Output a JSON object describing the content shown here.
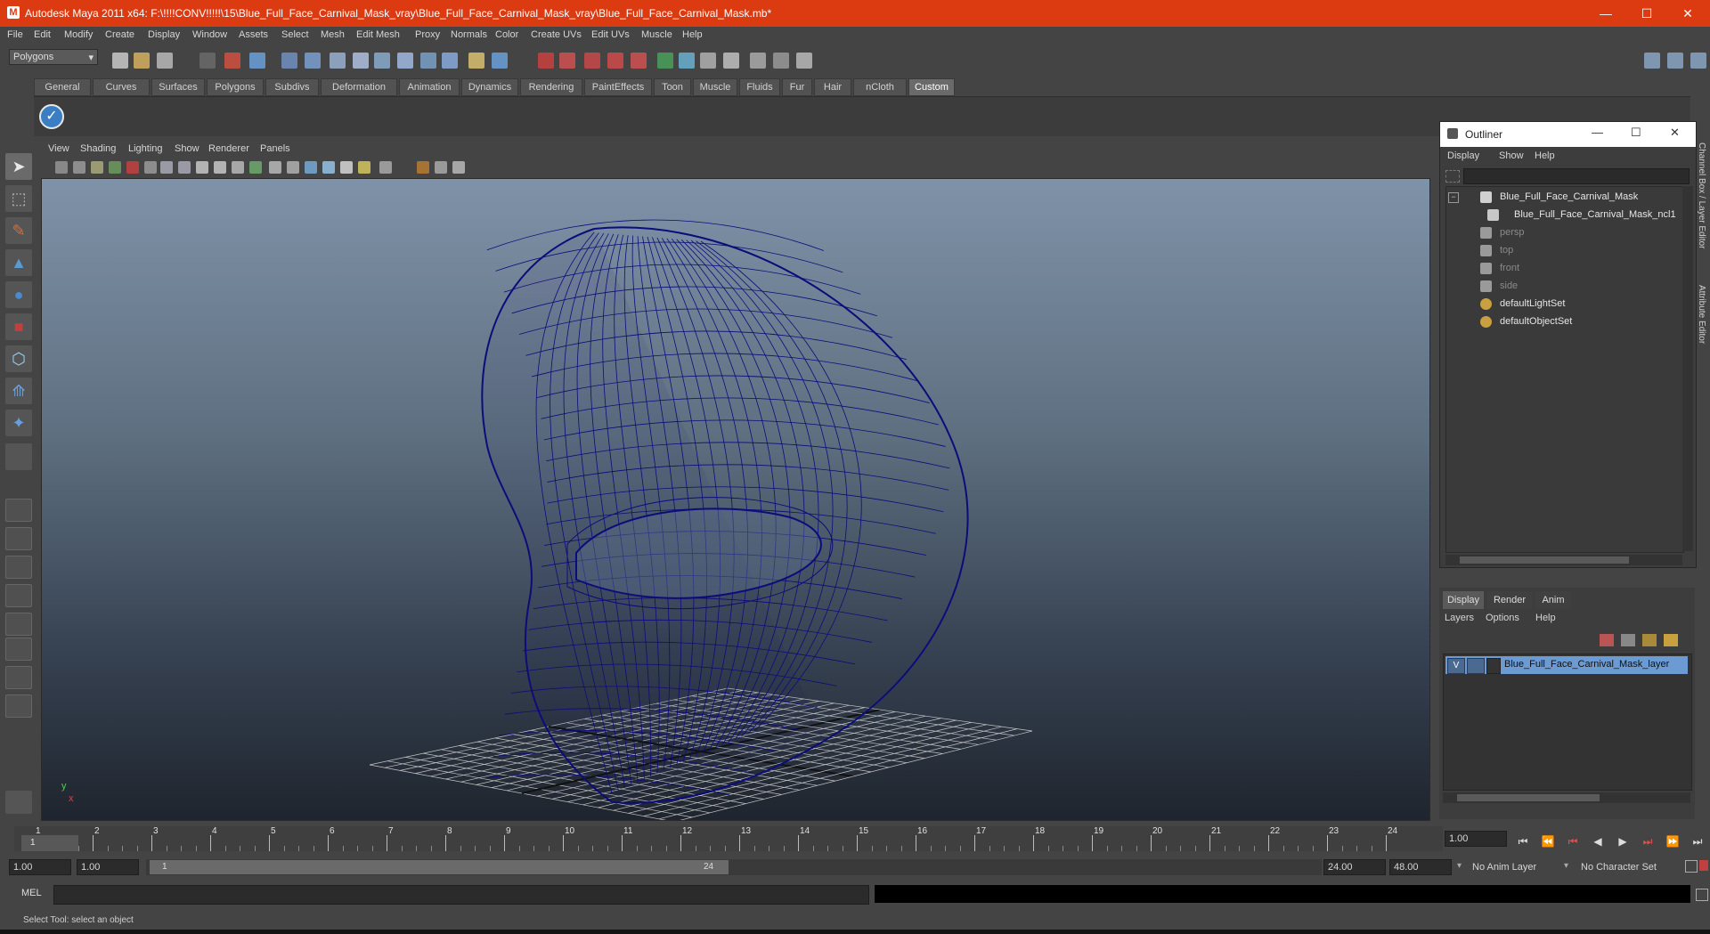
{
  "window": {
    "title": "Autodesk Maya 2011 x64: F:\\!!!!CONV!!!!!\\15\\Blue_Full_Face_Carnival_Mask_vray\\Blue_Full_Face_Carnival_Mask_vray\\Blue_Full_Face_Carnival_Mask.mb*",
    "minimize": "—",
    "maximize": "☐",
    "close": "✕"
  },
  "menubar": [
    "File",
    "Edit",
    "Modify",
    "Create",
    "Display",
    "Window",
    "Assets",
    "Select",
    "Mesh",
    "Edit Mesh",
    "Proxy",
    "Normals",
    "Color",
    "Create UVs",
    "Edit UVs",
    "Muscle",
    "Help"
  ],
  "status": {
    "menu_set": "Polygons"
  },
  "shelf": {
    "tabs": [
      "General",
      "Curves",
      "Surfaces",
      "Polygons",
      "Subdivs",
      "Deformation",
      "Animation",
      "Dynamics",
      "Rendering",
      "PaintEffects",
      "Toon",
      "Muscle",
      "Fluids",
      "Fur",
      "Hair",
      "nCloth",
      "Custom"
    ],
    "active": "Custom"
  },
  "panel_menu": [
    "View",
    "Shading",
    "Lighting",
    "Show",
    "Renderer",
    "Panels"
  ],
  "viewport": {
    "axis_x": "x",
    "axis_y": "y",
    "wire_color": "#0c0c7a"
  },
  "outliner": {
    "title": "Outliner",
    "menu": [
      "Display",
      "Show",
      "Help"
    ],
    "items": [
      {
        "label": "Blue_Full_Face_Carnival_Mask",
        "dim": false,
        "icon": "mesh-group-icon"
      },
      {
        "label": "Blue_Full_Face_Carnival_Mask_ncl1",
        "dim": false,
        "icon": "mesh-shape-icon"
      },
      {
        "label": "persp",
        "dim": true,
        "icon": "camera-icon"
      },
      {
        "label": "top",
        "dim": true,
        "icon": "camera-icon"
      },
      {
        "label": "front",
        "dim": true,
        "icon": "camera-icon"
      },
      {
        "label": "side",
        "dim": true,
        "icon": "camera-icon"
      },
      {
        "label": "defaultLightSet",
        "dim": false,
        "icon": "set-icon"
      },
      {
        "label": "defaultObjectSet",
        "dim": false,
        "icon": "set-icon"
      }
    ]
  },
  "side_tabs": {
    "channel_box": "Channel Box / Layer Editor",
    "attribute_editor": "Attribute Editor"
  },
  "layer_editor": {
    "tabs": [
      "Display",
      "Render",
      "Anim"
    ],
    "active_tab": "Display",
    "menu": [
      "Layers",
      "Options",
      "Help"
    ],
    "layer": {
      "visible": "V",
      "name": "Blue_Full_Face_Carnival_Mask_layer"
    }
  },
  "time_slider": {
    "ticks": [
      "1",
      "2",
      "3",
      "4",
      "5",
      "6",
      "7",
      "8",
      "9",
      "10",
      "11",
      "12",
      "13",
      "14",
      "15",
      "16",
      "17",
      "18",
      "19",
      "20",
      "21",
      "22",
      "23",
      "24"
    ],
    "current_frame_marker": "1",
    "current_time": "1.00"
  },
  "range_slider": {
    "start": "1.00",
    "anim_start": "1.00",
    "range_start": "1",
    "range_end": "24",
    "anim_end": "24.00",
    "end": "48.00",
    "anim_layer": "No Anim Layer",
    "char_set": "No Character Set"
  },
  "command_line": {
    "label": "MEL"
  },
  "help_line": {
    "text": "Select Tool: select an object"
  },
  "colors": {
    "title_bar": "#dc3b12",
    "selection": "#6b9bd2",
    "wireframe": "#0c0c7a"
  }
}
